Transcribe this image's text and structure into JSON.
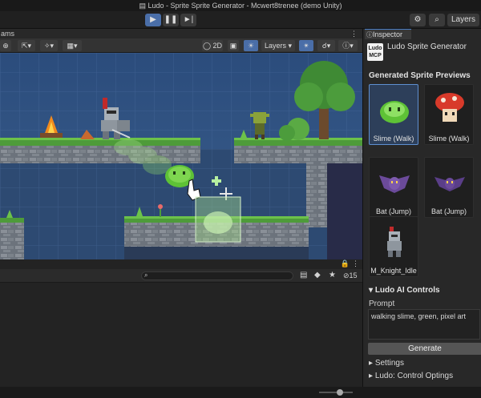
{
  "window": {
    "title": "Ludo - Sprite Sprite Generator - Mcwert8trenee (demo Unity)"
  },
  "toolbar": {
    "play_icon": "play-icon",
    "pause_icon": "pause-icon",
    "step_icon": "step-icon",
    "layers_label": "Layers"
  },
  "scene": {
    "tab_label": "ams",
    "mode_2d_label": "2D",
    "layers_label": "Layers"
  },
  "bottom": {
    "search_placeholder": "",
    "count_label": "15"
  },
  "inspector": {
    "tab_label": "Inspector",
    "logo_top": "Ludo",
    "logo_bottom": "MCP",
    "component_title": "Ludo Sprite Generator",
    "previews_title": "Generated Sprite Previews",
    "previews": [
      {
        "label": "Slime (Walk)",
        "selected": true
      },
      {
        "label": "Slime (Walk)",
        "selected": false
      },
      {
        "label": "Bat (Jump)",
        "selected": false
      },
      {
        "label": "Bat (Jump)",
        "selected": false
      },
      {
        "label": "M_Knight_Idle",
        "selected": false
      }
    ],
    "ai_controls_title": "Ludo AI Controls",
    "prompt_label": "Prompt",
    "prompt_value": "walking slime, green, pixel art",
    "generate_label": "Generate",
    "settings_label": "Settings",
    "control_options_label": "Ludo: Control Optings"
  }
}
